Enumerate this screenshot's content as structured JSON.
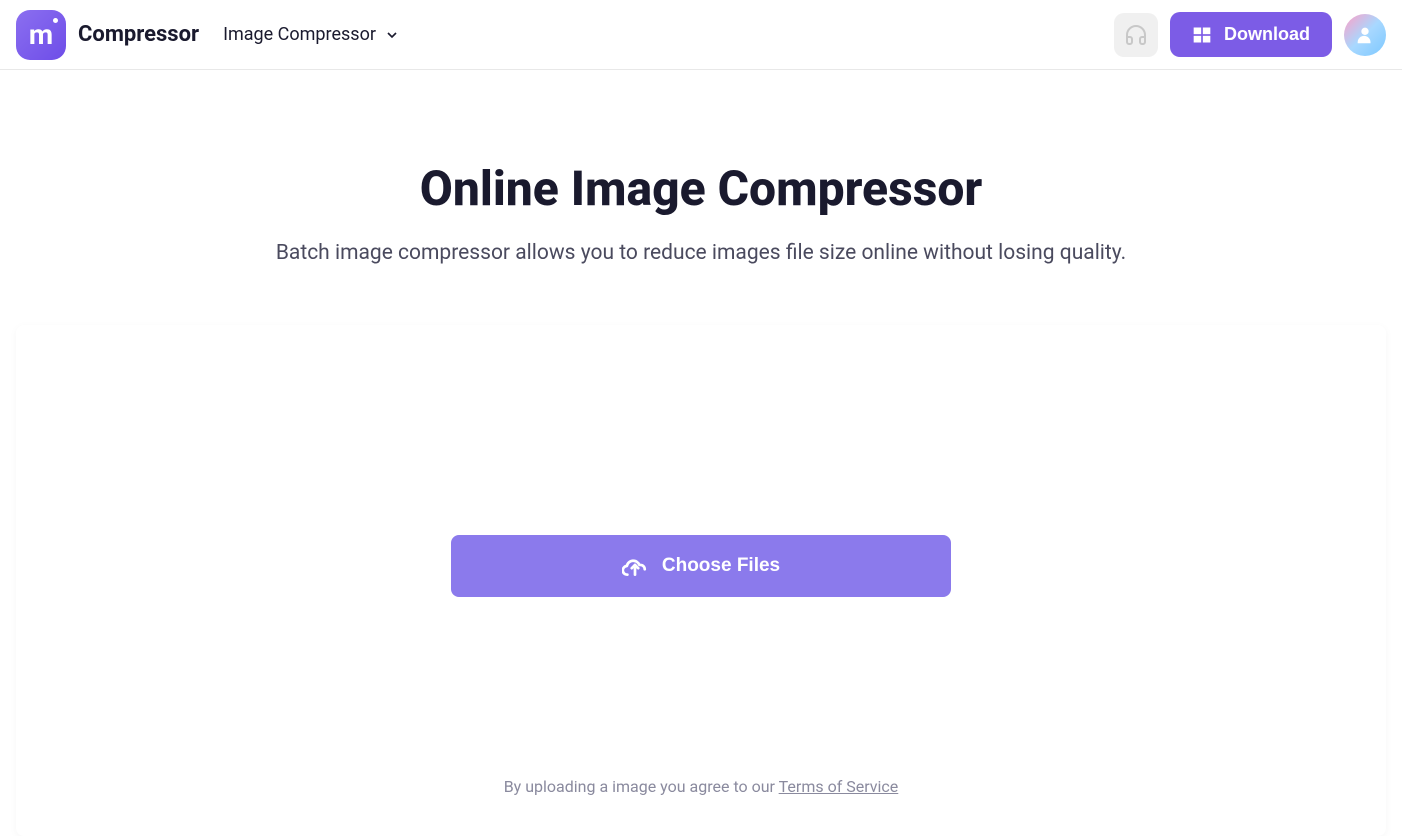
{
  "header": {
    "logo_text": "Compressor",
    "nav_dropdown_label": "Image Compressor",
    "download_button_label": "Download"
  },
  "main": {
    "title": "Online Image Compressor",
    "subtitle": "Batch image compressor allows you to reduce images file size online without losing quality.",
    "choose_files_label": "Choose Files",
    "terms_prefix": "By uploading a image you agree to our ",
    "terms_link_label": "Terms of Service"
  }
}
